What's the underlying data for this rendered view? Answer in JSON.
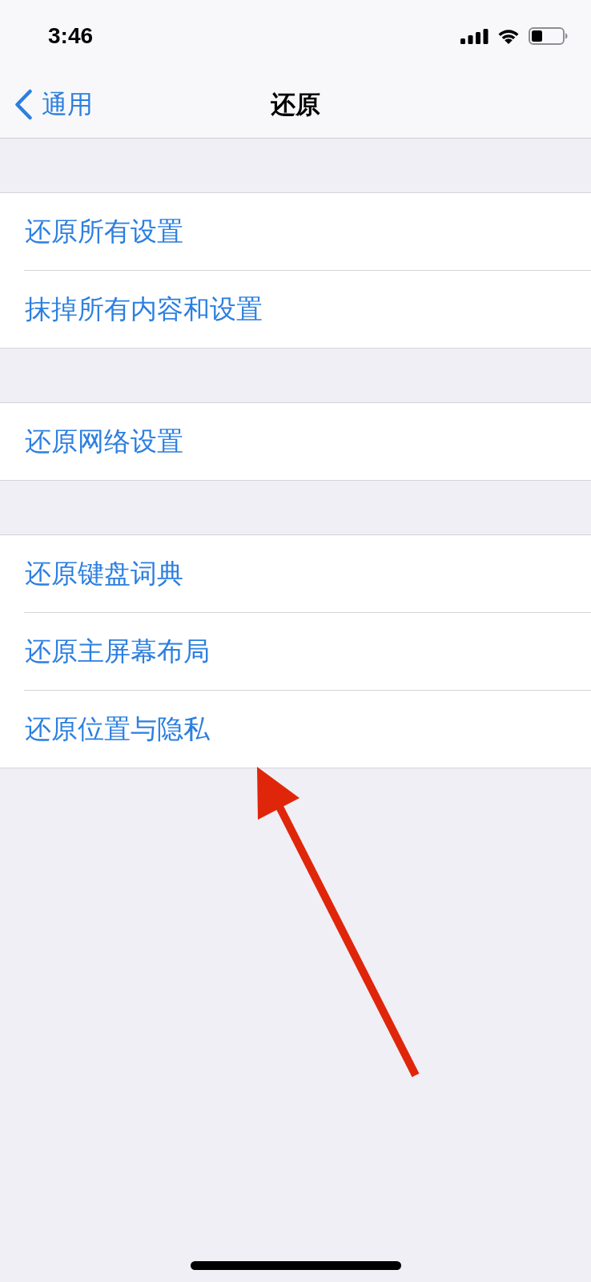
{
  "status_bar": {
    "time": "3:46"
  },
  "nav_bar": {
    "back": "通用",
    "title": "还原"
  },
  "groups": [
    {
      "items": [
        {
          "label": "还原所有设置"
        },
        {
          "label": "抹掉所有内容和设置"
        }
      ]
    },
    {
      "items": [
        {
          "label": "还原网络设置"
        }
      ]
    },
    {
      "items": [
        {
          "label": "还原键盘词典"
        },
        {
          "label": "还原主屏幕布局"
        },
        {
          "label": "还原位置与隐私"
        }
      ]
    }
  ]
}
